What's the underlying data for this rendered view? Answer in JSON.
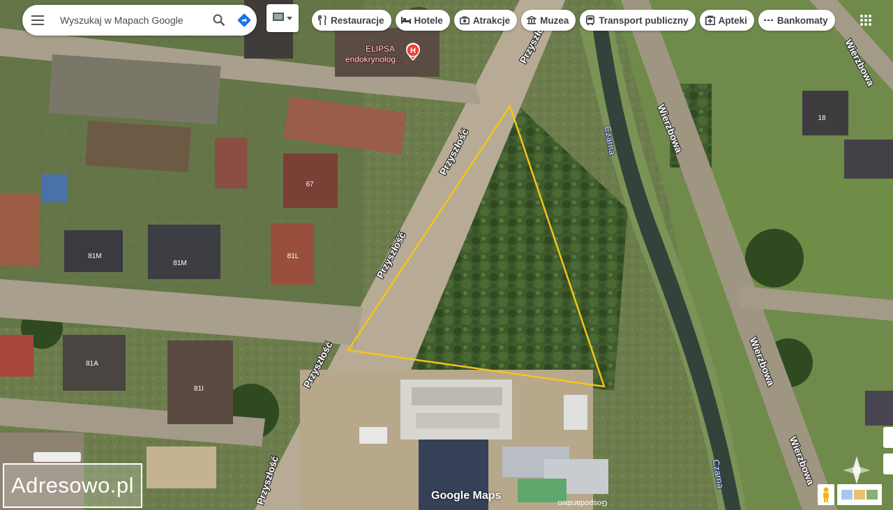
{
  "search": {
    "placeholder": "Wyszukaj w Mapach Google",
    "menu_icon": "hamburger-icon",
    "search_icon": "search-icon",
    "directions_icon": "directions-icon"
  },
  "layers": {
    "icon": "layers-icon",
    "dropdown_icon": "chevron-down-icon"
  },
  "categories": [
    {
      "label": "Restauracje",
      "icon": "fork-knife-icon"
    },
    {
      "label": "Hotele",
      "icon": "bed-icon"
    },
    {
      "label": "Atrakcje",
      "icon": "camera-icon"
    },
    {
      "label": "Muzea",
      "icon": "museum-icon"
    },
    {
      "label": "Transport publiczny",
      "icon": "bus-icon"
    },
    {
      "label": "Apteki",
      "icon": "pharmacy-icon"
    },
    {
      "label": "Bankomaty",
      "icon": "atm-icon"
    }
  ],
  "apps_icon": "apps-grid-icon",
  "places": {
    "poi_name": "ELIPSA",
    "poi_sub": "endokrynolog...",
    "poi_icon": "hospital-icon",
    "street_main": "Przyszłość",
    "street_east": "Wierzbowa",
    "river": "Czarna",
    "house_numbers": [
      "67",
      "81M",
      "81M",
      "81L",
      "81A",
      "81I",
      "18"
    ],
    "building_label": "Gospodarstwo"
  },
  "colors": {
    "plot_outline": "#f5c518",
    "accent": "#1a73e8",
    "poi_red": "#ea4335"
  },
  "watermark": "Adresowo.pl",
  "logo": "Google Maps",
  "controls": {
    "pegman_icon": "pegman-icon",
    "compass_icon": "compass-icon",
    "minimap_icon": "layer-thumbnail-icon"
  }
}
